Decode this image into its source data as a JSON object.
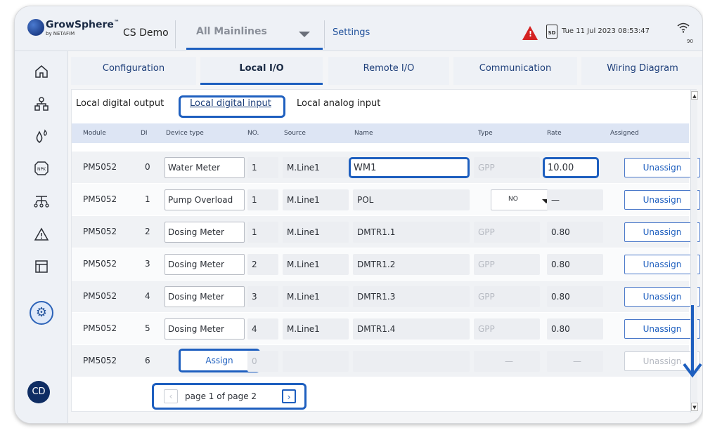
{
  "topbar": {
    "brand": "GrowSphere",
    "brand_tm": "™",
    "brand_by": "by NETAFIM",
    "site": "CS Demo",
    "mainline": "All Mainlines",
    "settings": "Settings",
    "alert_mark": "!",
    "sd_label": "SD",
    "datetime": "Tue 11 Jul 2023  08:53:47",
    "wifi_level": "90"
  },
  "user": {
    "initials": "CD"
  },
  "tabs": [
    {
      "label": "Configuration"
    },
    {
      "label": "Local I/O"
    },
    {
      "label": "Remote  I/O"
    },
    {
      "label": "Communication"
    },
    {
      "label": "Wiring Diagram"
    }
  ],
  "subtabs": [
    {
      "label": "Local digital output"
    },
    {
      "label": "Local digital input"
    },
    {
      "label": "Local analog input"
    }
  ],
  "table": {
    "headers": [
      "Module",
      "DI",
      "Device type",
      "NO.",
      "Source",
      "Name",
      "Type",
      "Rate",
      "Assigned"
    ],
    "rows": [
      {
        "module": "PM5052",
        "di": "0",
        "device": "Water Meter",
        "no": "1",
        "source": "M.Line1",
        "name": "WM1",
        "type": "GPP",
        "rate": "10.00",
        "assigned": "Unassign"
      },
      {
        "module": "PM5052",
        "di": "1",
        "device": "Pump Overload",
        "no": "1",
        "source": "M.Line1",
        "name": "POL",
        "type": "NO",
        "rate": "—",
        "assigned": "Unassign"
      },
      {
        "module": "PM5052",
        "di": "2",
        "device": "Dosing Meter",
        "no": "1",
        "source": "M.Line1",
        "name": "DMTR1.1",
        "type": "GPP",
        "rate": "0.80",
        "assigned": "Unassign"
      },
      {
        "module": "PM5052",
        "di": "3",
        "device": "Dosing Meter",
        "no": "2",
        "source": "M.Line1",
        "name": "DMTR1.2",
        "type": "GPP",
        "rate": "0.80",
        "assigned": "Unassign"
      },
      {
        "module": "PM5052",
        "di": "4",
        "device": "Dosing Meter",
        "no": "3",
        "source": "M.Line1",
        "name": "DMTR1.3",
        "type": "GPP",
        "rate": "0.80",
        "assigned": "Unassign"
      },
      {
        "module": "PM5052",
        "di": "5",
        "device": "Dosing Meter",
        "no": "4",
        "source": "M.Line1",
        "name": "DMTR1.4",
        "type": "GPP",
        "rate": "0.80",
        "assigned": "Unassign"
      },
      {
        "module": "PM5052",
        "di": "6",
        "device": "Assign",
        "no": "0",
        "source": "",
        "name": "",
        "type": "—",
        "rate": "—",
        "assigned": "Unassign"
      }
    ]
  },
  "pager": {
    "label": "page 1 of page 2",
    "prev": "‹",
    "next": "›"
  },
  "colors": {
    "accent": "#1e5fbf",
    "alert": "#d42222",
    "header_bg": "#dde5f4"
  }
}
